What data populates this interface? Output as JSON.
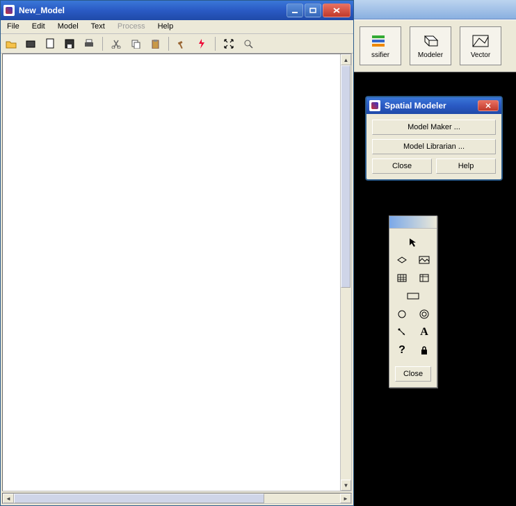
{
  "main_window": {
    "title": "New_Model",
    "menubar": [
      "File",
      "Edit",
      "Model",
      "Text",
      "Process",
      "Help"
    ],
    "menubar_disabled_index": 4,
    "toolbar_icons": [
      "open-icon",
      "new-folder-icon",
      "new-icon",
      "save-icon",
      "print-icon",
      "cut-icon",
      "copy-icon",
      "paste-icon",
      "hammer-icon",
      "lightning-icon",
      "expand-icon",
      "zoom-icon"
    ]
  },
  "right_toolbar": {
    "buttons": [
      {
        "label": "ssifier",
        "icon": "classifier-icon"
      },
      {
        "label": "Modeler",
        "icon": "modeler-icon"
      },
      {
        "label": "Vector",
        "icon": "vector-icon"
      }
    ]
  },
  "dialog": {
    "title": "Spatial Modeler",
    "model_maker": "Model Maker ...",
    "model_librarian": "Model Librarian ...",
    "close": "Close",
    "help": "Help"
  },
  "palette": {
    "tools": [
      "arrow-icon",
      "",
      "raster-icon",
      "image-icon",
      "matrix-icon",
      "table-icon",
      "scalar-icon",
      "",
      "circle-icon",
      "function-icon",
      "connect-icon",
      "text-icon",
      "help-icon",
      "lock-icon"
    ],
    "close": "Close"
  }
}
